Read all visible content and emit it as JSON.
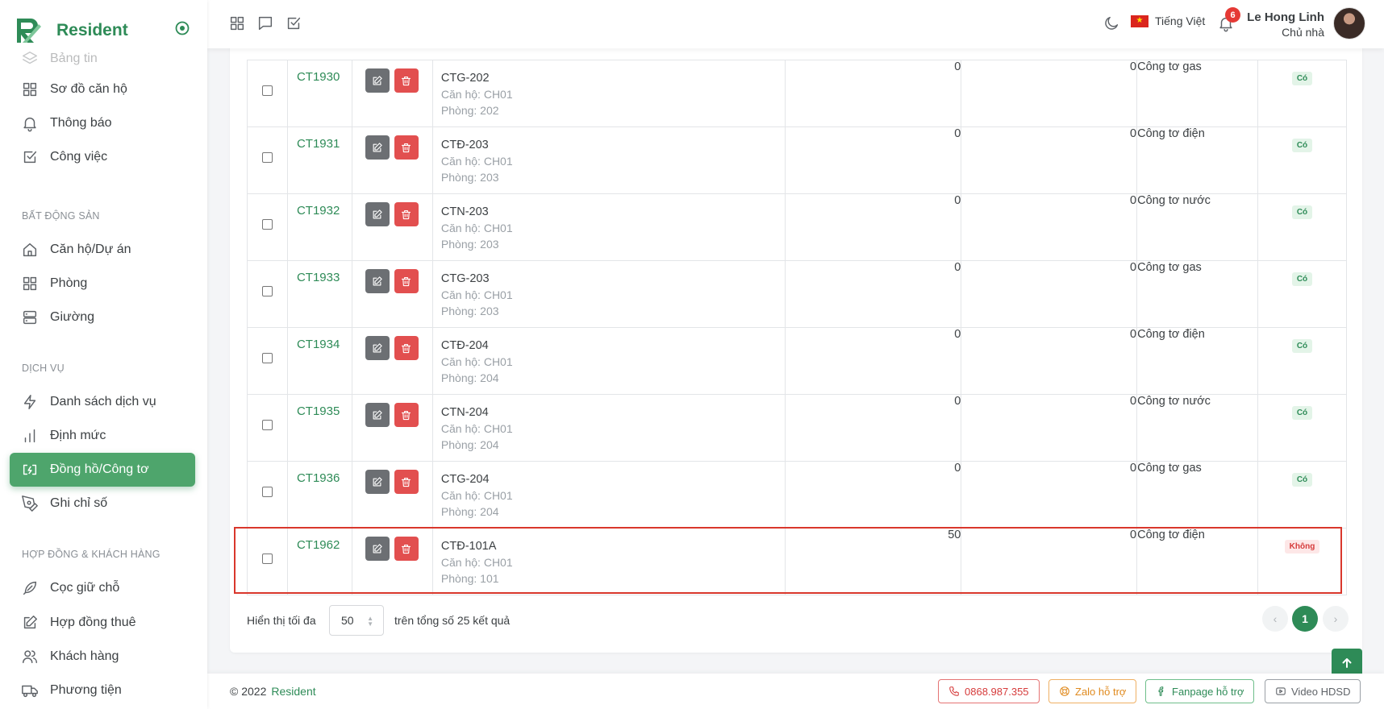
{
  "brand": {
    "name": "Resident"
  },
  "sidebar": {
    "partial_item": "Bảng tin",
    "items_top": [
      {
        "label": "Sơ đồ căn hộ"
      },
      {
        "label": "Thông báo"
      },
      {
        "label": "Công việc"
      }
    ],
    "section_real_estate": "BẤT ĐỘNG SẢN",
    "items_real_estate": [
      {
        "label": "Căn hộ/Dự án"
      },
      {
        "label": "Phòng"
      },
      {
        "label": "Giường"
      }
    ],
    "section_services": "DỊCH VỤ",
    "items_services": [
      {
        "label": "Danh sách dịch vụ"
      },
      {
        "label": "Định mức"
      },
      {
        "label": "Đồng hồ/Công tơ"
      },
      {
        "label": "Ghi chỉ số"
      }
    ],
    "section_contracts": "HỢP ĐỒNG & KHÁCH HÀNG",
    "items_contracts": [
      {
        "label": "Cọc giữ chỗ"
      },
      {
        "label": "Hợp đồng thuê"
      },
      {
        "label": "Khách hàng"
      },
      {
        "label": "Phương tiện"
      }
    ]
  },
  "topbar": {
    "language": "Tiếng Việt",
    "notification_count": "6",
    "user_name": "Le Hong Linh",
    "user_role": "Chủ nhà"
  },
  "table": {
    "rows": [
      {
        "code": "CT1930",
        "name": "CTG-202",
        "apartment": "Căn hộ: CH01",
        "room": "Phòng: 202",
        "value1": "0",
        "value2": "0",
        "type": "Công tơ gas",
        "status": "Có",
        "status_kind": "yes"
      },
      {
        "code": "CT1931",
        "name": "CTĐ-203",
        "apartment": "Căn hộ: CH01",
        "room": "Phòng: 203",
        "value1": "0",
        "value2": "0",
        "type": "Công tơ điện",
        "status": "Có",
        "status_kind": "yes"
      },
      {
        "code": "CT1932",
        "name": "CTN-203",
        "apartment": "Căn hộ: CH01",
        "room": "Phòng: 203",
        "value1": "0",
        "value2": "0",
        "type": "Công tơ nước",
        "status": "Có",
        "status_kind": "yes"
      },
      {
        "code": "CT1933",
        "name": "CTG-203",
        "apartment": "Căn hộ: CH01",
        "room": "Phòng: 203",
        "value1": "0",
        "value2": "0",
        "type": "Công tơ gas",
        "status": "Có",
        "status_kind": "yes"
      },
      {
        "code": "CT1934",
        "name": "CTĐ-204",
        "apartment": "Căn hộ: CH01",
        "room": "Phòng: 204",
        "value1": "0",
        "value2": "0",
        "type": "Công tơ điện",
        "status": "Có",
        "status_kind": "yes"
      },
      {
        "code": "CT1935",
        "name": "CTN-204",
        "apartment": "Căn hộ: CH01",
        "room": "Phòng: 204",
        "value1": "0",
        "value2": "0",
        "type": "Công tơ nước",
        "status": "Có",
        "status_kind": "yes"
      },
      {
        "code": "CT1936",
        "name": "CTG-204",
        "apartment": "Căn hộ: CH01",
        "room": "Phòng: 204",
        "value1": "0",
        "value2": "0",
        "type": "Công tơ gas",
        "status": "Có",
        "status_kind": "yes"
      },
      {
        "code": "CT1962",
        "name": "CTĐ-101A",
        "apartment": "Căn hộ: CH01",
        "room": "Phòng: 101",
        "value1": "50",
        "value2": "0",
        "type": "Công tơ điện",
        "status": "Không",
        "status_kind": "no"
      }
    ]
  },
  "pagination": {
    "show_label": "Hiển thị tối đa",
    "page_size": "50",
    "total_label": "trên tổng số 25 kết quả",
    "prev": "‹",
    "next": "›",
    "current_page": "1"
  },
  "footer": {
    "copyright": "© 2022",
    "brand_link": "Resident",
    "phone": "0868.987.355",
    "zalo": "Zalo hỗ trợ",
    "fanpage": "Fanpage hỗ trợ",
    "video": "Video HDSD"
  },
  "colors": {
    "accent": "#2e8b57",
    "active_nav": "#4ea56c",
    "danger": "#e24f4f",
    "highlight_border": "#d9372c"
  }
}
